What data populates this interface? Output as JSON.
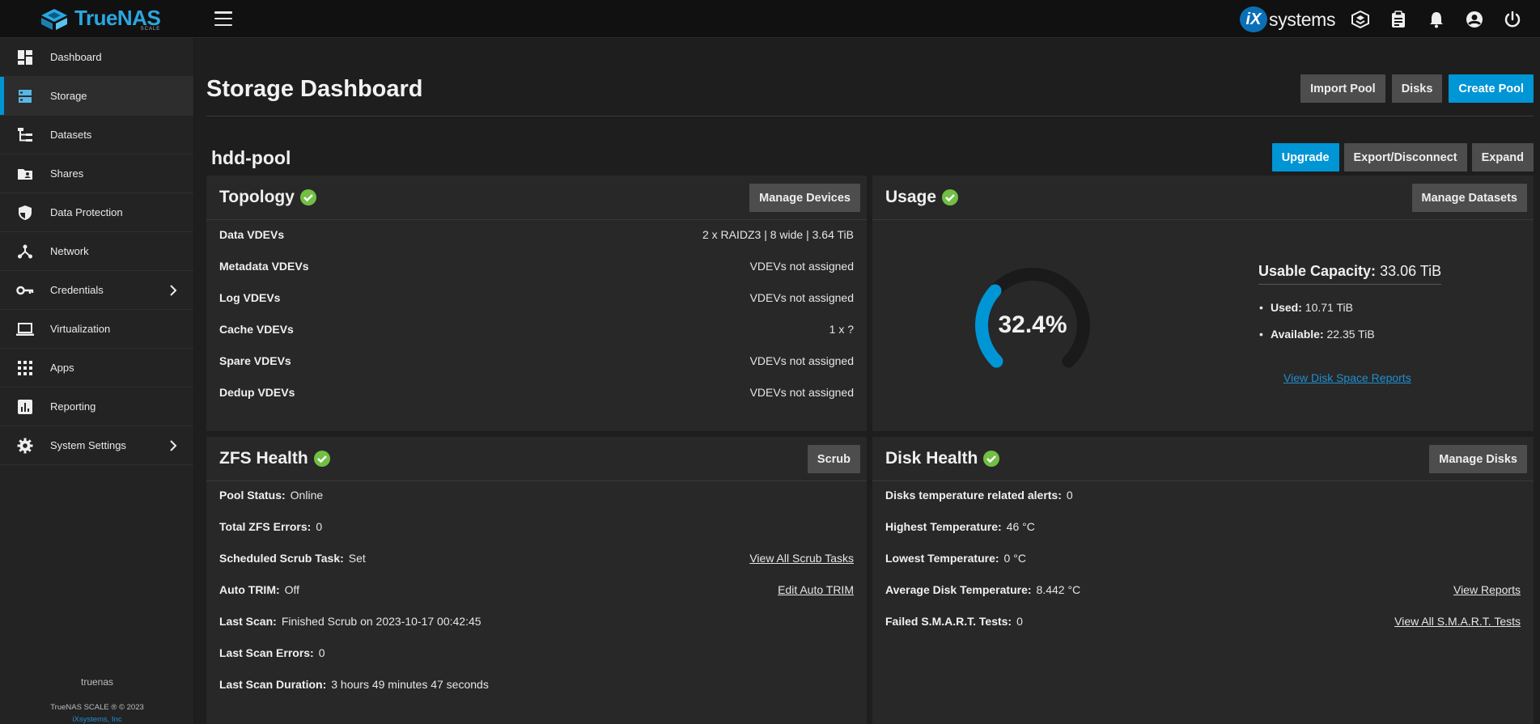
{
  "topbar": {
    "logo_name": "TrueNAS",
    "logo_sub": "SCALE",
    "ix_badge": "iX",
    "ix_text": "systems",
    "icons": [
      "truecommand-icon",
      "clipboard-icon",
      "bell-icon",
      "account-icon",
      "power-icon"
    ]
  },
  "sidebar": {
    "items": [
      {
        "label": "Dashboard",
        "icon": "dashboard-icon"
      },
      {
        "label": "Storage",
        "icon": "storage-icon"
      },
      {
        "label": "Datasets",
        "icon": "datasets-icon"
      },
      {
        "label": "Shares",
        "icon": "shares-icon"
      },
      {
        "label": "Data Protection",
        "icon": "shield-icon"
      },
      {
        "label": "Network",
        "icon": "network-icon"
      },
      {
        "label": "Credentials",
        "icon": "key-icon"
      },
      {
        "label": "Virtualization",
        "icon": "laptop-icon"
      },
      {
        "label": "Apps",
        "icon": "apps-icon"
      },
      {
        "label": "Reporting",
        "icon": "reporting-icon"
      },
      {
        "label": "System Settings",
        "icon": "gear-icon"
      }
    ],
    "active": "Storage",
    "hostname": "truenas",
    "copyright": "TrueNAS SCALE ® © 2023",
    "company": "iXsystems, Inc"
  },
  "header": {
    "title": "Storage Dashboard",
    "import_pool": "Import Pool",
    "disks": "Disks",
    "create_pool": "Create Pool"
  },
  "pool": {
    "name": "hdd-pool",
    "upgrade": "Upgrade",
    "export": "Export/Disconnect",
    "expand": "Expand"
  },
  "topology": {
    "title": "Topology",
    "button": "Manage Devices",
    "rows": [
      {
        "k": "Data VDEVs",
        "v": "2 x RAIDZ3 | 8 wide | 3.64 TiB"
      },
      {
        "k": "Metadata VDEVs",
        "v": "VDEVs not assigned"
      },
      {
        "k": "Log VDEVs",
        "v": "VDEVs not assigned"
      },
      {
        "k": "Cache VDEVs",
        "v": "1 x ?"
      },
      {
        "k": "Spare VDEVs",
        "v": "VDEVs not assigned"
      },
      {
        "k": "Dedup VDEVs",
        "v": "VDEVs not assigned"
      }
    ]
  },
  "usage": {
    "title": "Usage",
    "button": "Manage Datasets",
    "percent_label": "32.4%",
    "percent": 32.4,
    "capacity_label": "Usable Capacity:",
    "capacity_value": "33.06 TiB",
    "used_label": "Used:",
    "used_value": "10.71 TiB",
    "available_label": "Available:",
    "available_value": "22.35 TiB",
    "reports_link": "View Disk Space Reports"
  },
  "zfs": {
    "title": "ZFS Health",
    "button": "Scrub",
    "pool_status_k": "Pool Status:",
    "pool_status_v": "Online",
    "errors_k": "Total ZFS Errors:",
    "errors_v": "0",
    "scrub_task_k": "Scheduled Scrub Task:",
    "scrub_task_v": "Set",
    "scrub_link": "View All Scrub Tasks",
    "trim_k": "Auto TRIM:",
    "trim_v": "Off",
    "trim_link": "Edit Auto TRIM",
    "last_scan_k": "Last Scan:",
    "last_scan_v": "Finished Scrub on 2023-10-17 00:42:45",
    "scan_errors_k": "Last Scan Errors:",
    "scan_errors_v": "0",
    "scan_duration_k": "Last Scan Duration:",
    "scan_duration_v": "3 hours 49 minutes 47 seconds"
  },
  "disk_health": {
    "title": "Disk Health",
    "button": "Manage Disks",
    "temp_alerts_k": "Disks temperature related alerts:",
    "temp_alerts_v": "0",
    "highest_k": "Highest Temperature:",
    "highest_v": "46 °C",
    "lowest_k": "Lowest Temperature:",
    "lowest_v": "0 °C",
    "avg_k": "Average Disk Temperature:",
    "avg_v": "8.442 °C",
    "reports_link": "View Reports",
    "smart_k": "Failed S.M.A.R.T. Tests:",
    "smart_v": "0",
    "smart_link": "View All S.M.A.R.T. Tests"
  },
  "colors": {
    "accent": "#0095d5",
    "ok": "#71bf44",
    "gauge_track": "#1a1a1a"
  }
}
